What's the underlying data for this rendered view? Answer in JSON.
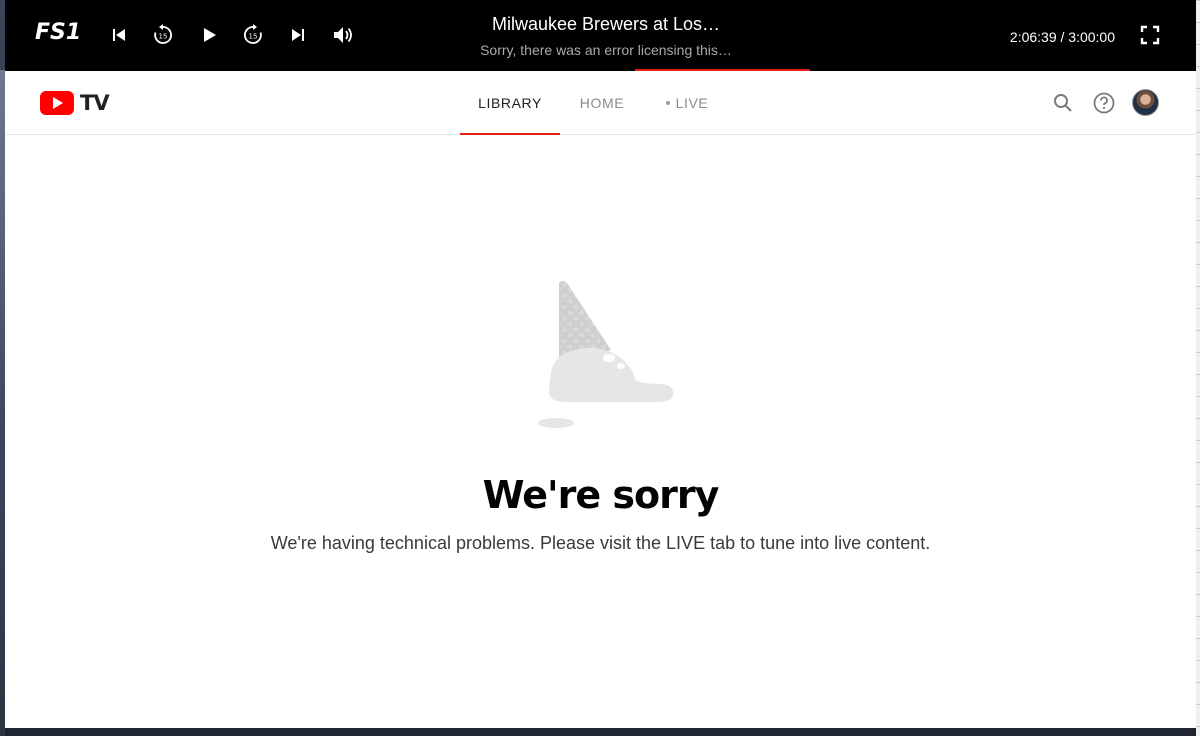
{
  "player": {
    "channel_logo": "FS1",
    "title": "Milwaukee Brewers at Los…",
    "subtitle": "Sorry, there was an error licensing this…",
    "time": "2:06:39 / 3:00:00",
    "progress": 0.7,
    "controls": [
      "skip-previous-icon",
      "rewind-15-icon",
      "play-icon",
      "forward-15-icon",
      "skip-next-icon",
      "volume-icon",
      "fullscreen-icon"
    ],
    "accent": "#e52117"
  },
  "header": {
    "logo_text": "TV",
    "tabs": [
      {
        "label": "LIBRARY",
        "active": true
      },
      {
        "label": "HOME",
        "active": false
      },
      {
        "label": "LIVE",
        "active": false
      }
    ],
    "icons": [
      "search-icon",
      "help-icon",
      "avatar"
    ]
  },
  "main": {
    "illustration": "dropped-ice-cream-cone",
    "title": "We're sorry",
    "message": "We're having technical problems. Please visit the LIVE tab to tune into live content."
  }
}
